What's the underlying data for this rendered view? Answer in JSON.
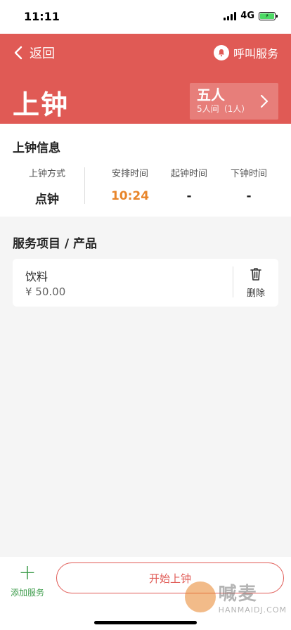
{
  "status_bar": {
    "time": "11:11",
    "network": "4G"
  },
  "header": {
    "back_label": "返回",
    "call_label": "呼叫服务",
    "title": "上钟",
    "room": {
      "name": "五人",
      "sub": "5人间（1人）"
    },
    "color": "#e05a55"
  },
  "info": {
    "title": "上钟信息",
    "columns": [
      {
        "label": "上钟方式",
        "value": "点钟"
      },
      {
        "label": "安排时间",
        "value": "10:24"
      },
      {
        "label": "起钟时间",
        "value": "-"
      },
      {
        "label": "下钟时间",
        "value": "-"
      }
    ]
  },
  "services": {
    "title": "服务项目 / 产品",
    "items": [
      {
        "name": "饮料",
        "price": "¥ 50.00",
        "delete_label": "删除"
      }
    ]
  },
  "bottom": {
    "add_label": "添加服务",
    "start_label": "开始上钟"
  },
  "watermark": {
    "brand": "喊麦",
    "domain": "HANMAIDJ.COM"
  },
  "icons": [
    "chevron-left-icon",
    "bell-icon",
    "chevron-right-icon",
    "trash-icon",
    "plus-icon"
  ]
}
